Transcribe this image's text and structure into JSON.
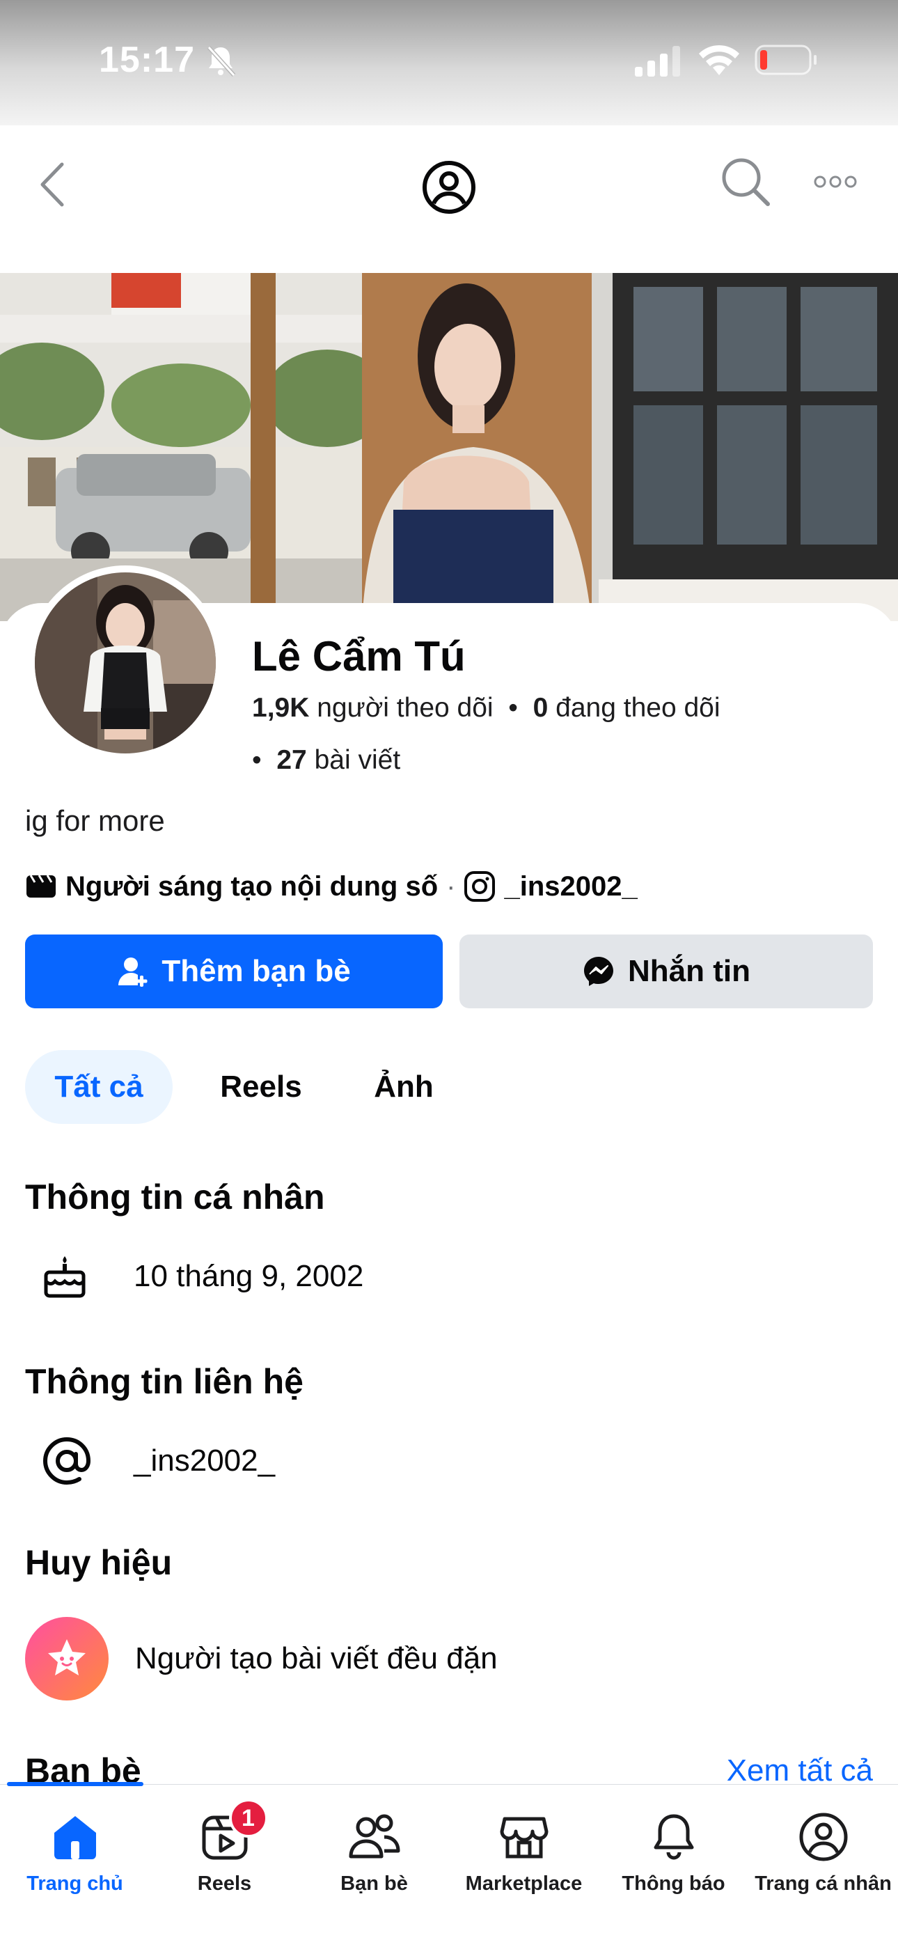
{
  "status_bar": {
    "time": "15:17"
  },
  "profile": {
    "name": "Lê Cẩm Tú",
    "followers_count": "1,9K",
    "followers_label": "người theo dõi",
    "following_count": "0",
    "following_label": "đang theo dõi",
    "posts_count": "27",
    "posts_label": "bài viết",
    "bio": "ig for more",
    "category": "Người sáng tạo nội dung số",
    "instagram": "_ins2002_"
  },
  "actions": {
    "add_friend": "Thêm bạn bè",
    "message": "Nhắn tin"
  },
  "tabs": [
    {
      "label": "Tất cả",
      "active": true
    },
    {
      "label": "Reels",
      "active": false
    },
    {
      "label": "Ảnh",
      "active": false
    }
  ],
  "personal_info": {
    "title": "Thông tin cá nhân",
    "birthday": "10 tháng 9, 2002"
  },
  "contact_info": {
    "title": "Thông tin liên hệ",
    "instagram": "_ins2002_"
  },
  "badges": {
    "title": "Huy hiệu",
    "badge": "Người tạo bài viết đều đặn"
  },
  "friends": {
    "title": "Bạn bè",
    "see_all": "Xem tất cả"
  },
  "bottom_tabs": [
    {
      "label": "Trang chủ",
      "icon": "home-icon",
      "active": true
    },
    {
      "label": "Reels",
      "icon": "reels-icon",
      "badge": "1"
    },
    {
      "label": "Bạn bè",
      "icon": "friends-icon"
    },
    {
      "label": "Marketplace",
      "icon": "marketplace-icon"
    },
    {
      "label": "Thông báo",
      "icon": "bell-icon"
    },
    {
      "label": "Trang cá nhân",
      "icon": "profile-icon"
    }
  ],
  "colors": {
    "accent": "#0866ff",
    "badge_red": "#e41e3f",
    "secondary_button": "#e2e5e9"
  }
}
